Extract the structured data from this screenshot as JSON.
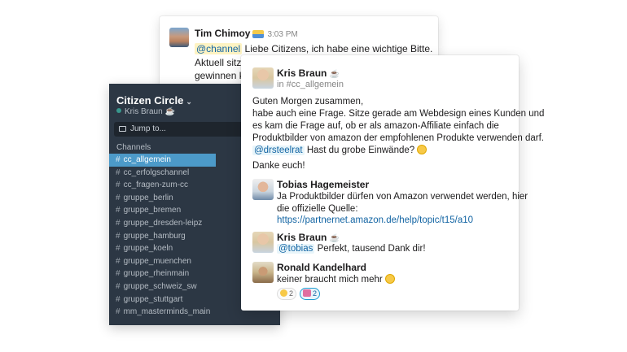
{
  "back_message": {
    "author": "Tim Chimoy",
    "time": "3:03 PM",
    "mention": "@channel",
    "line1_rest": " Liebe Citizens, ich habe eine wichtige Bitte.",
    "line2": "Aktuell sitze",
    "line3": "gewinnen ko"
  },
  "sidebar": {
    "workspace": "Citizen Circle",
    "chevron": "⌄",
    "user": "Kris Braun",
    "user_emoji": "☕",
    "jump_to": "Jump to...",
    "channels_header": "Channels",
    "hash": "#",
    "channels": [
      {
        "label": "cc_allgemein"
      },
      {
        "label": "cc_erfolgschannel"
      },
      {
        "label": "cc_fragen-zum-cc"
      },
      {
        "label": "gruppe_berlin"
      },
      {
        "label": "gruppe_bremen"
      },
      {
        "label": "gruppe_dresden-leipz"
      },
      {
        "label": "gruppe_hamburg"
      },
      {
        "label": "gruppe_koeln"
      },
      {
        "label": "gruppe_muenchen"
      },
      {
        "label": "gruppe_rheinmain"
      },
      {
        "label": "gruppe_schweiz_sw"
      },
      {
        "label": "gruppe_stuttgart"
      },
      {
        "label": "mm_masterminds_main"
      }
    ],
    "active_channel": "cc_allgemein"
  },
  "thread": {
    "parent": {
      "author": "Kris Braun",
      "author_emoji": "☕",
      "channel_ref": "in #cc_allgemein",
      "lines": [
        "Guten Morgen zusammen,",
        "habe auch eine Frage. Sitze gerade am Webdesign eines Kunden und",
        "es kam die Frage auf, ob er als amazon-Affiliate einfach die",
        "Produktbilder von amazon der empfohlenen Produkte verwenden darf."
      ],
      "mention": "@drsteelrat",
      "mention_rest": " Hast du grobe Einwände?",
      "closing": "Danke euch!"
    },
    "reply1": {
      "author": "Tobias Hagemeister",
      "line1": "Ja Produktbilder dürfen von Amazon verwendet werden, hier",
      "line2": "die offizielle Quelle:",
      "link": "https://partnernet.amazon.de/help/topic/t15/a10"
    },
    "reply2": {
      "author": "Kris Braun",
      "author_emoji": "☕",
      "mention": "@tobias",
      "text": " Perfekt, tausend Dank dir!"
    },
    "reply3": {
      "author": "Ronald Kandelhard",
      "text": "keiner braucht mich mehr",
      "reactions": [
        {
          "icon": "grinning-emoji-icon",
          "count": "2"
        },
        {
          "icon": "heart-emoji-icon",
          "count": "2"
        }
      ]
    }
  }
}
